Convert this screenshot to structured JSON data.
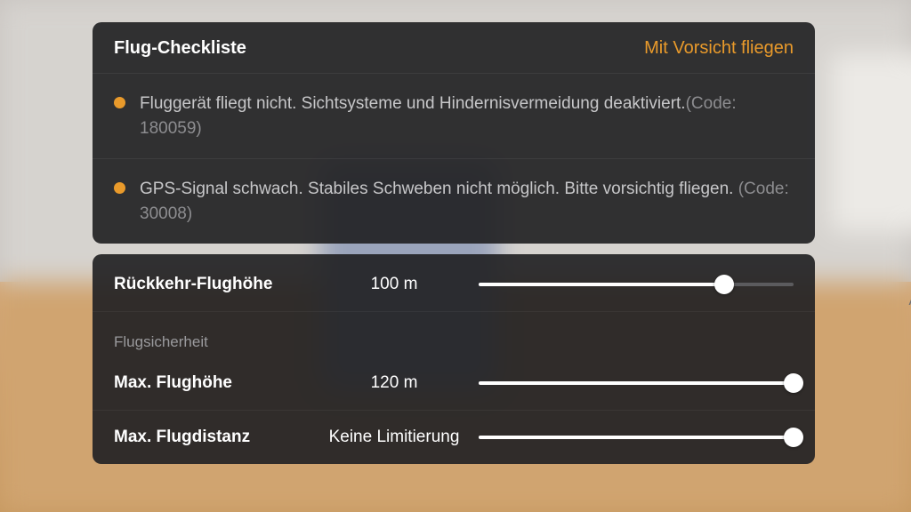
{
  "colors": {
    "accent": "#e99a2b"
  },
  "checklist": {
    "title": "Flug-Checkliste",
    "status": "Mit Vorsicht fliegen",
    "items": [
      {
        "msg": "Fluggerät fliegt nicht. Sichtsysteme und Hindernisvermeidung deaktiviert.",
        "code": "(Code: 180059)"
      },
      {
        "msg": "GPS-Signal schwach. Stabiles Schweben nicht möglich. Bitte vorsichtig fliegen. ",
        "code": "(Code: 30008)"
      }
    ]
  },
  "settings": {
    "rth": {
      "label": "Rückkehr-Flughöhe",
      "value": "100 m",
      "percent": 78
    },
    "section": "Flugsicherheit",
    "maxAlt": {
      "label": "Max. Flughöhe",
      "value": "120 m",
      "percent": 100
    },
    "maxDist": {
      "label": "Max. Flugdistanz",
      "value": "Keine Limitierung",
      "percent": 100
    }
  },
  "sideLabel": "AF"
}
